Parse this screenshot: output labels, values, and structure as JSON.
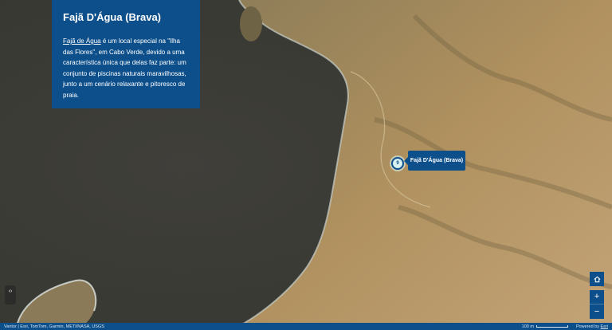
{
  "info_panel": {
    "title": "Fajã D'Água (Brava)",
    "link_text": "Fajã de Água",
    "body": " é um local especial na \"Ilha das Flores\", em Cabo Verde, devido a uma característica única que delas faz parte: um conjunto de piscinas naturais maravilhosas, junto a um cenário relaxante e pitoresco de praia."
  },
  "marker": {
    "number": "9",
    "popup_label": "Fajã D'Água (Brava)"
  },
  "controls": {
    "home_icon": "home-icon",
    "zoom_in": "+",
    "zoom_out": "−",
    "nav_toggle": "‹›"
  },
  "footer": {
    "attribution": "Vantor | Esri, TomTom, Garmin, METI/NASA, USGS",
    "scale_label": "100 m",
    "powered_prefix": "Powered by ",
    "powered_brand": "Esri"
  },
  "colors": {
    "panel": "#0d4f8a",
    "ocean": "#3a3c38",
    "land": "#a88a5a"
  }
}
